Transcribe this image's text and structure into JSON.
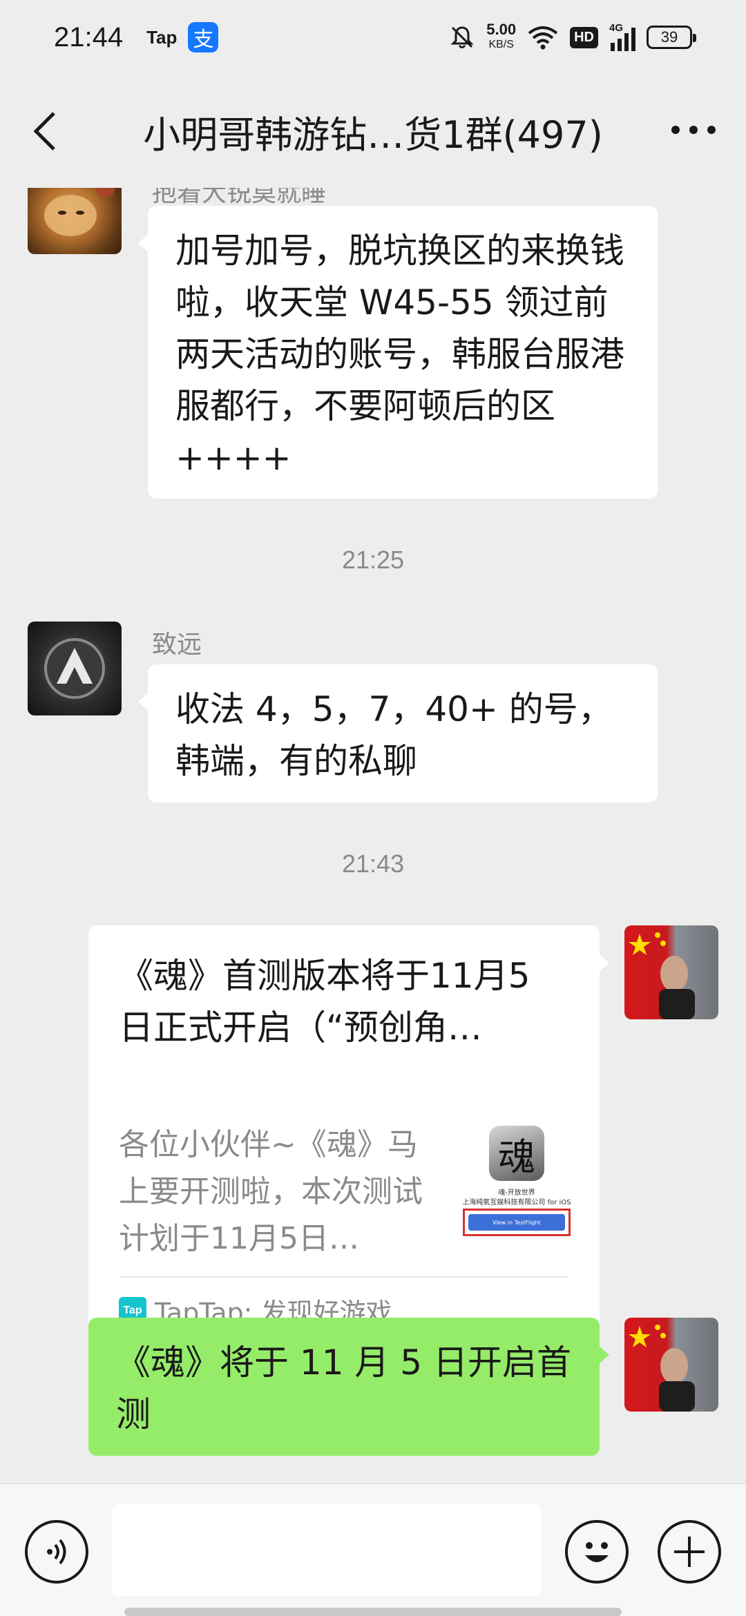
{
  "status_bar": {
    "time": "21:44",
    "app_badge": "Tap",
    "alipay_glyph": "支",
    "speed_value": "5.00",
    "speed_unit": "KB/S",
    "hd": "HD",
    "network": "4G",
    "battery": "39"
  },
  "nav": {
    "title": "小明哥韩游钻…货1群(497)"
  },
  "messages": {
    "partial_name": "抱着大锐莫就睡",
    "msg1": "加号加号，脱坑换区的来换钱啦，收天堂 W45-55 领过前两天活动的账号，韩服台服港服都行，不要阿顿后的区 ++++",
    "time1": "21:25",
    "sender2": "致远",
    "msg2": "收法 4，5，7，40+ 的号，韩端，有的私聊",
    "time2": "21:43",
    "card": {
      "title": "《魂》首测版本将于11月5日正式开启（“预创角…",
      "desc": "各位小伙伴~《魂》马上要开测啦，本次测试计划于11月5日…",
      "thumb_glyph": "魂",
      "thumb_line1": "魂-开放世界",
      "thumb_line2": "上海纯氧互娱科技有限公司 for iOS",
      "thumb_button": "View in TestFlight",
      "source_logo": "Tap",
      "source": "TapTap: 发现好游戏"
    },
    "msg3": "《魂》将于 11 月 5 日开启首测"
  },
  "icons": {
    "back": "chevron-left-icon",
    "more": "more-dots-icon",
    "voice": "voice-icon",
    "emoji": "emoji-icon",
    "plus": "plus-icon"
  },
  "colors": {
    "background": "#ededed",
    "bubble_white": "#ffffff",
    "bubble_green": "#95ec69",
    "muted_text": "#8a8a8a",
    "taptap_teal": "#15c5ce"
  }
}
